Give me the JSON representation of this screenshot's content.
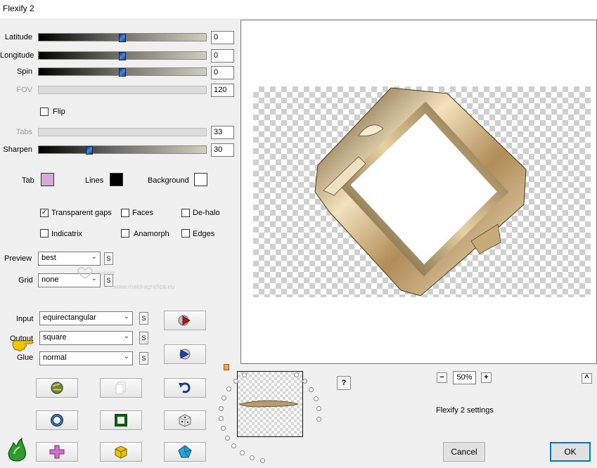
{
  "window": {
    "title": "Flexify 2"
  },
  "sliders": [
    {
      "label": "Latitude",
      "value": "0",
      "position": 0.5,
      "enabled": true
    },
    {
      "label": "Longitude",
      "value": "0",
      "position": 0.5,
      "enabled": true
    },
    {
      "label": "Spin",
      "value": "0",
      "position": 0.5,
      "enabled": true
    },
    {
      "label": "FOV",
      "value": "120",
      "enabled": false
    },
    {
      "label": "Tabs",
      "value": "33",
      "enabled": false
    },
    {
      "label": "Sharpen",
      "value": "30",
      "position": 0.3,
      "enabled": true
    }
  ],
  "flip": {
    "label": "Flip",
    "checked": false
  },
  "swatches": {
    "tab": {
      "label": "Tab",
      "color": "#d8a8d8"
    },
    "lines": {
      "label": "Lines",
      "color": "#000000"
    },
    "background": {
      "label": "Background",
      "color": "#ffffff"
    }
  },
  "options": {
    "transparent_gaps": {
      "label": "Transparent gaps",
      "checked": true,
      "mark": "✓"
    },
    "faces": {
      "label": "Faces",
      "checked": false
    },
    "dehalo": {
      "label": "De-halo",
      "checked": false
    },
    "indicatrix": {
      "label": "Indicatrix",
      "checked": false
    },
    "anamorph": {
      "label": "Anamorph",
      "checked": false
    },
    "edges": {
      "label": "Edges",
      "checked": false
    }
  },
  "preview": {
    "label": "Preview",
    "value": "best"
  },
  "grid": {
    "label": "Grid",
    "value": "none"
  },
  "input": {
    "label": "Input",
    "value": "equirectangular"
  },
  "output": {
    "label": "Output",
    "value": "square"
  },
  "glue": {
    "label": "Glue",
    "value": "normal"
  },
  "s_label": "S",
  "watermark": {
    "line1": "muscia",
    "line2": "www.maldragrafica.eu"
  },
  "help": "?",
  "zoom": {
    "minus": "−",
    "value": "50%",
    "plus": "+"
  },
  "collapse": "^",
  "settings_name": "Flexify 2 settings",
  "cancel": "Cancel",
  "ok": "OK",
  "colors": {
    "accent": "#0078d7",
    "gold": "#c8ac7a"
  }
}
